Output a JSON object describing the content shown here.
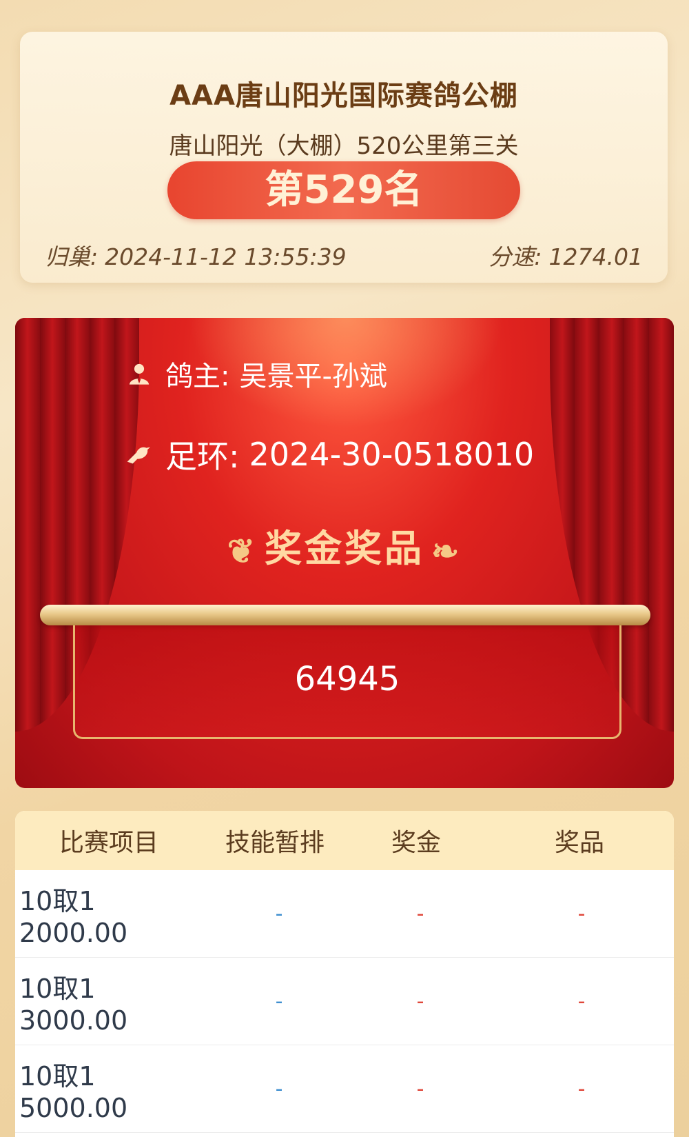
{
  "header": {
    "club_name": "AAA唐山阳光国际赛鸽公棚",
    "race_name": "唐山阳光（大棚）520公里第三关",
    "rank": "第529名",
    "return_label": "归巢:",
    "return_time": "2024-11-12 13:55:39",
    "speed_label": "分速:",
    "speed_value": "1274.01"
  },
  "stage": {
    "owner_label": "鸽主:",
    "owner_name": "吴景平-孙斌",
    "ring_label": "足环:",
    "ring_number": "2024-30-0518010",
    "prize_title": "奖金奖品",
    "prize_amount": "64945",
    "icons": [
      "person-icon",
      "pigeon-icon",
      "laurel-icon"
    ]
  },
  "table": {
    "headers": [
      "比赛项目",
      "技能暂排",
      "奖金",
      "奖品"
    ],
    "rows": [
      {
        "item": "10取1 2000.00",
        "rank": "-",
        "bonus": "-",
        "prize": "-"
      },
      {
        "item": "10取1 3000.00",
        "rank": "-",
        "bonus": "-",
        "prize": "-"
      },
      {
        "item": "10取1 5000.00",
        "rank": "-",
        "bonus": "-",
        "prize": "-"
      }
    ]
  },
  "colors": {
    "accent_red": "#e0231f",
    "gold": "#e8b66e",
    "header_bg": "#fdebbf",
    "dash_blue": "#3f8fd0",
    "dash_red": "#e0473a"
  }
}
